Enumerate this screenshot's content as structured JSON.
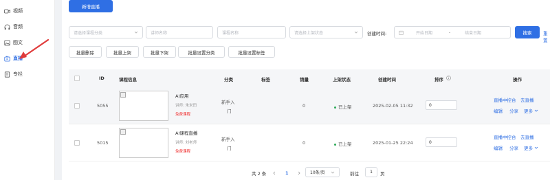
{
  "sidebar": {
    "items": [
      {
        "label": "视频",
        "icon": "video-icon"
      },
      {
        "label": "音频",
        "icon": "headphones-icon"
      },
      {
        "label": "图文",
        "icon": "image-text-icon"
      },
      {
        "label": "直播",
        "icon": "live-icon"
      },
      {
        "label": "专栏",
        "icon": "column-icon"
      }
    ],
    "active_index": 3
  },
  "toolbar": {
    "new_live_label": "新增直播",
    "search_label": "搜索",
    "reset_label": "重置"
  },
  "filters": {
    "category_placeholder": "请选择课程分类",
    "teacher_placeholder": "讲师名称",
    "course_placeholder": "课程名称",
    "status_placeholder": "请选择上架状态",
    "created_label": "创建时间:",
    "start_placeholder": "开始日期",
    "range_sep": "-",
    "end_placeholder": "结束日期"
  },
  "batch": {
    "delete": "批量删除",
    "publish": "批量上架",
    "unpublish": "批量下架",
    "set_category": "批量设置分类",
    "set_tags": "批量设置标签"
  },
  "table": {
    "headers": {
      "id": "ID",
      "info": "课程信息",
      "category": "分类",
      "tags": "标签",
      "sales": "销量",
      "status": "上架状态",
      "created": "创建时间",
      "sort": "排序",
      "actions": "操作"
    },
    "rows": [
      {
        "id": "5055",
        "title": "AI应用",
        "teacher": "讲师: 朱米田",
        "badge": "免费课程",
        "category_line1": "新手入",
        "category_line2": "门",
        "sales": "0",
        "status": "已上架",
        "created": "2025-02-05 11:32",
        "sort": "0",
        "actions": {
          "console": "直播中控台",
          "go_live": "去直播",
          "edit": "编辑",
          "share": "分享",
          "more": "更多"
        }
      },
      {
        "id": "5015",
        "title": "AI课程直播",
        "teacher": "讲师: 刘老师",
        "badge": "免费课程",
        "category_line1": "新手入",
        "category_line2": "门",
        "sales": "0",
        "status": "已上架",
        "created": "2025-01-25 22:24",
        "sort": "0",
        "actions": {
          "console": "直播中控台",
          "go_live": "去直播",
          "edit": "编辑",
          "share": "分享",
          "more": "更多"
        }
      }
    ]
  },
  "pagination": {
    "total": "共 2 条",
    "current_page": "1",
    "page_size": "10条/页",
    "goto_label": "前往",
    "goto_value": "1",
    "page_suffix": "页"
  },
  "colors": {
    "accent": "#2f6fe4",
    "danger": "#f03030",
    "success": "#2faa5a"
  }
}
